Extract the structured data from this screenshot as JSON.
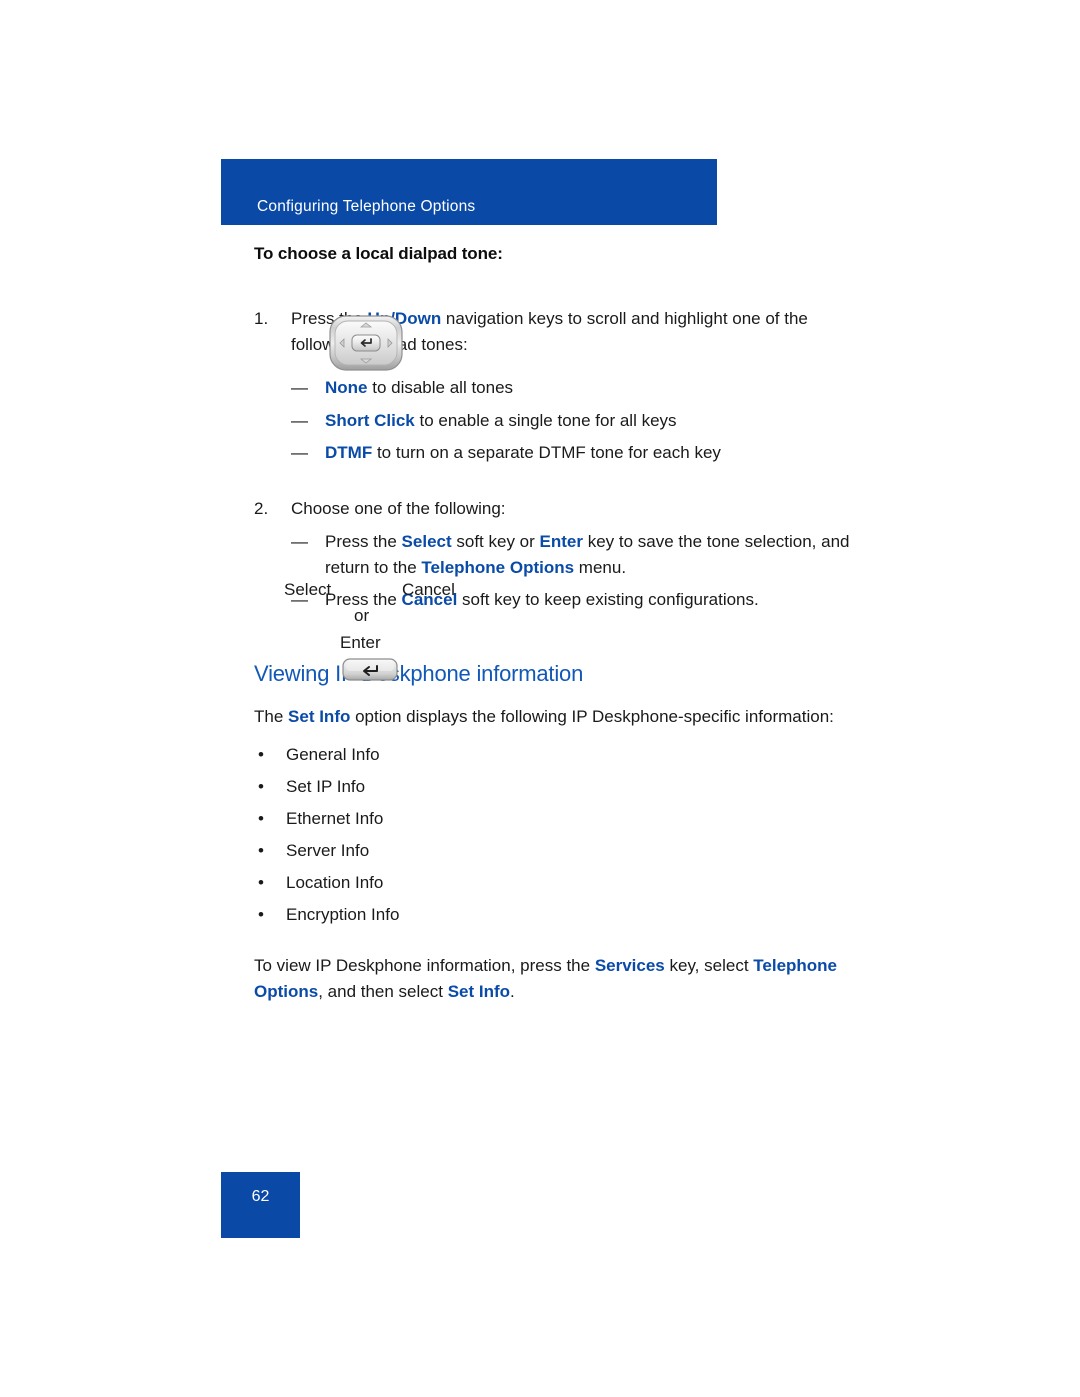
{
  "header": {
    "title": "Configuring Telephone Options",
    "bg_color": "#0a4aa6"
  },
  "procedure": {
    "title": "To choose a local dialpad tone:",
    "steps": [
      {
        "number": "1.",
        "text_parts": [
          {
            "text": "Press the ",
            "style": "normal"
          },
          {
            "text": "Up/Down",
            "style": "accent"
          },
          {
            "text": " navigation keys to scroll and highlight one of the following dialpad tones:",
            "style": "normal"
          }
        ],
        "sub_items": [
          {
            "dash": "—",
            "parts": [
              {
                "text": "None",
                "style": "accent"
              },
              {
                "text": " to disable all tones",
                "style": "normal"
              }
            ]
          },
          {
            "dash": "—",
            "parts": [
              {
                "text": "Short Click",
                "style": "accent"
              },
              {
                "text": " to enable a single tone for all keys",
                "style": "normal"
              }
            ]
          },
          {
            "dash": "—",
            "parts": [
              {
                "text": "DTMF",
                "style": "accent"
              },
              {
                "text": " to turn on a separate DTMF tone for each key",
                "style": "normal"
              }
            ]
          }
        ]
      },
      {
        "number": "2.",
        "text_parts": [
          {
            "text": "Choose one of the following:",
            "style": "normal"
          }
        ],
        "sub_items": [
          {
            "dash": "—",
            "parts": [
              {
                "text": "Press the ",
                "style": "normal"
              },
              {
                "text": "Select",
                "style": "accent"
              },
              {
                "text": " soft key or ",
                "style": "normal"
              },
              {
                "text": "Enter",
                "style": "accent"
              },
              {
                "text": " key to save the tone selection, and return to the ",
                "style": "normal"
              },
              {
                "text": "Telephone Options",
                "style": "accent"
              },
              {
                "text": " menu.",
                "style": "normal"
              }
            ]
          },
          {
            "dash": "—",
            "parts": [
              {
                "text": "Press the ",
                "style": "normal"
              },
              {
                "text": "Cancel",
                "style": "accent"
              },
              {
                "text": " soft key to keep existing configurations.",
                "style": "normal"
              }
            ]
          }
        ]
      }
    ]
  },
  "key_captions": {
    "select": "Select",
    "cancel": "Cancel",
    "or": "or",
    "enter": "Enter"
  },
  "icons": {
    "navigation_cluster": "navigation-cluster-icon",
    "enter_key": "enter-key-icon"
  },
  "section": {
    "heading": "Viewing IP Deskphone information",
    "intro_parts": [
      {
        "text": "The ",
        "style": "normal"
      },
      {
        "text": "Set Info",
        "style": "accent"
      },
      {
        "text": " option displays the following IP Deskphone-specific information:",
        "style": "normal"
      }
    ],
    "bullet_mark": "•",
    "bullets": [
      "General Info",
      "Set IP Info",
      "Ethernet Info",
      "Server Info",
      "Location Info",
      "Encryption Info"
    ],
    "closing_parts": [
      {
        "text": "To view IP Deskphone information, press the ",
        "style": "normal"
      },
      {
        "text": "Services",
        "style": "accent"
      },
      {
        "text": " key, select ",
        "style": "normal"
      },
      {
        "text": "Telephone Options",
        "style": "accent"
      },
      {
        "text": ", and then select ",
        "style": "normal"
      },
      {
        "text": "Set Info",
        "style": "accent"
      },
      {
        "text": ".",
        "style": "normal"
      }
    ]
  },
  "footer": {
    "page_number": "62",
    "bg_color": "#0a4aa6"
  },
  "colors": {
    "accent_blue": "#0b4ba8",
    "heading_blue": "#1258b8",
    "banner_blue": "#0a4aa6",
    "body_text": "#1a1a1a"
  }
}
